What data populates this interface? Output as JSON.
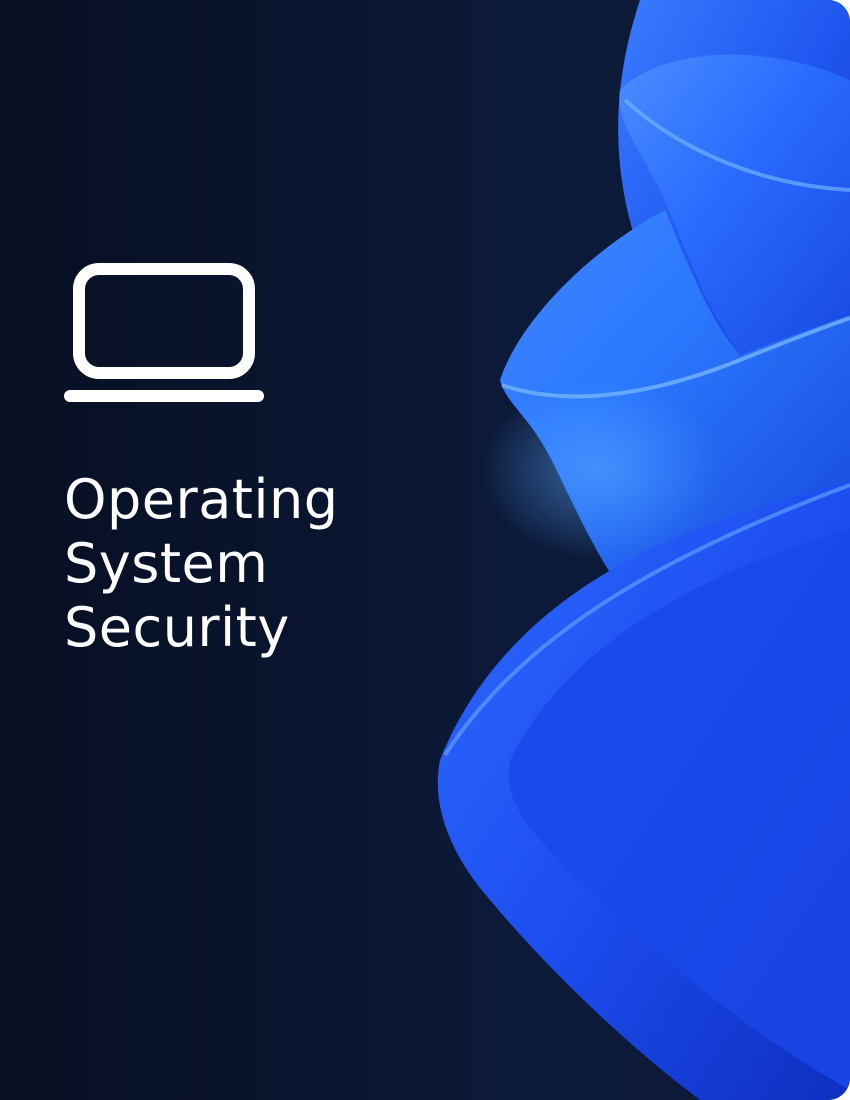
{
  "card": {
    "icon": "laptop-icon",
    "title_lines": [
      "Operating",
      "System",
      "Security"
    ]
  },
  "colors": {
    "background": "#0a1530",
    "accent_blue": "#1f5cff",
    "text": "#ffffff"
  }
}
